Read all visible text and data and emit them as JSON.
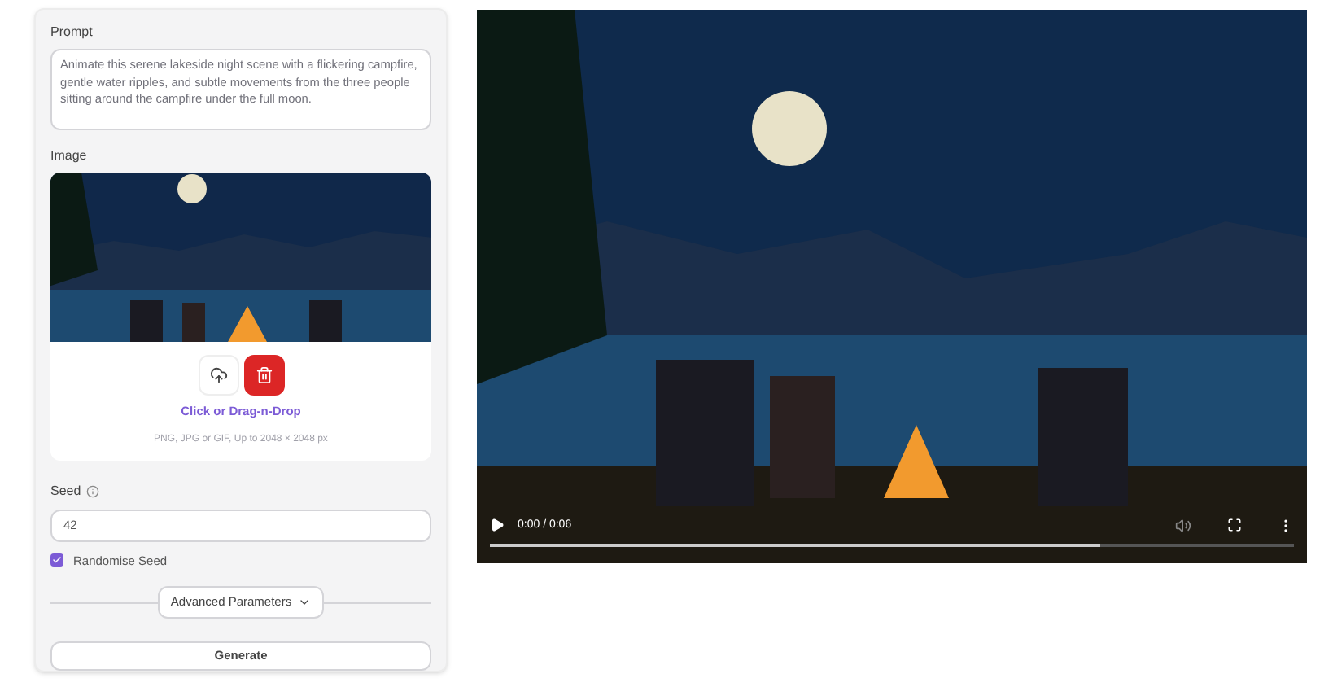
{
  "prompt": {
    "label": "Prompt",
    "value": "Animate this serene lakeside night scene with a flickering campfire, gentle water ripples, and subtle movements from the three people sitting around the campfire under the full moon."
  },
  "image": {
    "label": "Image",
    "upload_text": "Click or Drag-n-Drop",
    "hint": "PNG, JPG or GIF, Up to 2048 × 2048 px"
  },
  "seed": {
    "label": "Seed",
    "value": "42"
  },
  "randomise": {
    "label": "Randomise Seed",
    "checked": true
  },
  "advanced": {
    "label": "Advanced Parameters",
    "expanded": false
  },
  "generate": {
    "label": "Generate"
  },
  "video": {
    "time": "0:00 / 0:06"
  }
}
